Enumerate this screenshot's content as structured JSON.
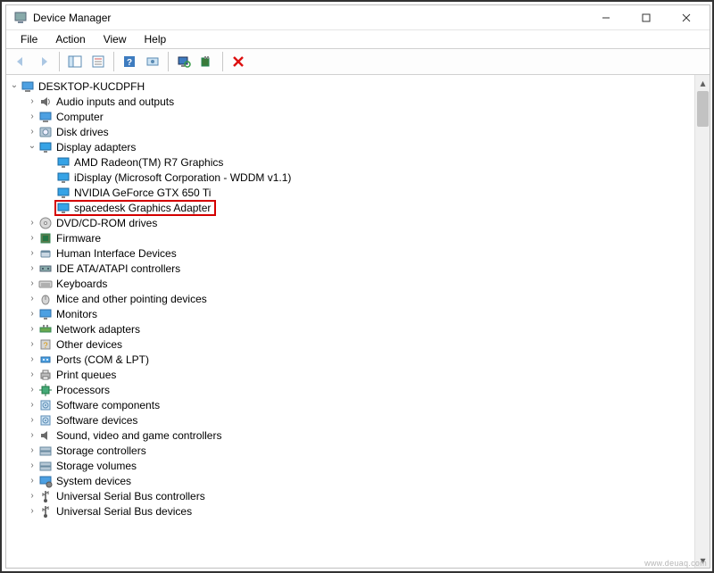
{
  "window": {
    "title": "Device Manager"
  },
  "menu": {
    "file": "File",
    "action": "Action",
    "view": "View",
    "help": "Help"
  },
  "toolbar": {
    "back": "Back",
    "forward": "Forward",
    "show_hide_tree": "Show/Hide Console Tree",
    "properties": "Properties",
    "help": "Help",
    "update_driver": "Update Driver",
    "scan_hardware": "Scan for hardware changes",
    "add_legacy": "Add legacy hardware",
    "uninstall": "Uninstall device"
  },
  "tree": {
    "root": {
      "label": "DESKTOP-KUCDPFH",
      "expanded": true,
      "icon": "computer"
    },
    "categories": [
      {
        "label": "Audio inputs and outputs",
        "expanded": false,
        "icon": "audio"
      },
      {
        "label": "Computer",
        "expanded": false,
        "icon": "computer"
      },
      {
        "label": "Disk drives",
        "expanded": false,
        "icon": "disk"
      },
      {
        "label": "Display adapters",
        "expanded": true,
        "icon": "display",
        "children": [
          {
            "label": "AMD Radeon(TM) R7 Graphics",
            "icon": "display"
          },
          {
            "label": "iDisplay (Microsoft Corporation - WDDM v1.1)",
            "icon": "display"
          },
          {
            "label": "NVIDIA GeForce GTX 650 Ti",
            "icon": "display"
          },
          {
            "label": "spacedesk Graphics Adapter",
            "icon": "display",
            "highlighted": true
          }
        ]
      },
      {
        "label": "DVD/CD-ROM drives",
        "expanded": false,
        "icon": "dvd"
      },
      {
        "label": "Firmware",
        "expanded": false,
        "icon": "firmware"
      },
      {
        "label": "Human Interface Devices",
        "expanded": false,
        "icon": "hid"
      },
      {
        "label": "IDE ATA/ATAPI controllers",
        "expanded": false,
        "icon": "ide"
      },
      {
        "label": "Keyboards",
        "expanded": false,
        "icon": "keyboard"
      },
      {
        "label": "Mice and other pointing devices",
        "expanded": false,
        "icon": "mouse"
      },
      {
        "label": "Monitors",
        "expanded": false,
        "icon": "monitor"
      },
      {
        "label": "Network adapters",
        "expanded": false,
        "icon": "network"
      },
      {
        "label": "Other devices",
        "expanded": false,
        "icon": "other"
      },
      {
        "label": "Ports (COM & LPT)",
        "expanded": false,
        "icon": "port"
      },
      {
        "label": "Print queues",
        "expanded": false,
        "icon": "printer"
      },
      {
        "label": "Processors",
        "expanded": false,
        "icon": "cpu"
      },
      {
        "label": "Software components",
        "expanded": false,
        "icon": "software"
      },
      {
        "label": "Software devices",
        "expanded": false,
        "icon": "software"
      },
      {
        "label": "Sound, video and game controllers",
        "expanded": false,
        "icon": "sound"
      },
      {
        "label": "Storage controllers",
        "expanded": false,
        "icon": "storage"
      },
      {
        "label": "Storage volumes",
        "expanded": false,
        "icon": "storage"
      },
      {
        "label": "System devices",
        "expanded": false,
        "icon": "system"
      },
      {
        "label": "Universal Serial Bus controllers",
        "expanded": false,
        "icon": "usb"
      },
      {
        "label": "Universal Serial Bus devices",
        "expanded": false,
        "icon": "usb"
      }
    ]
  },
  "watermark": "www.deuaq.com"
}
